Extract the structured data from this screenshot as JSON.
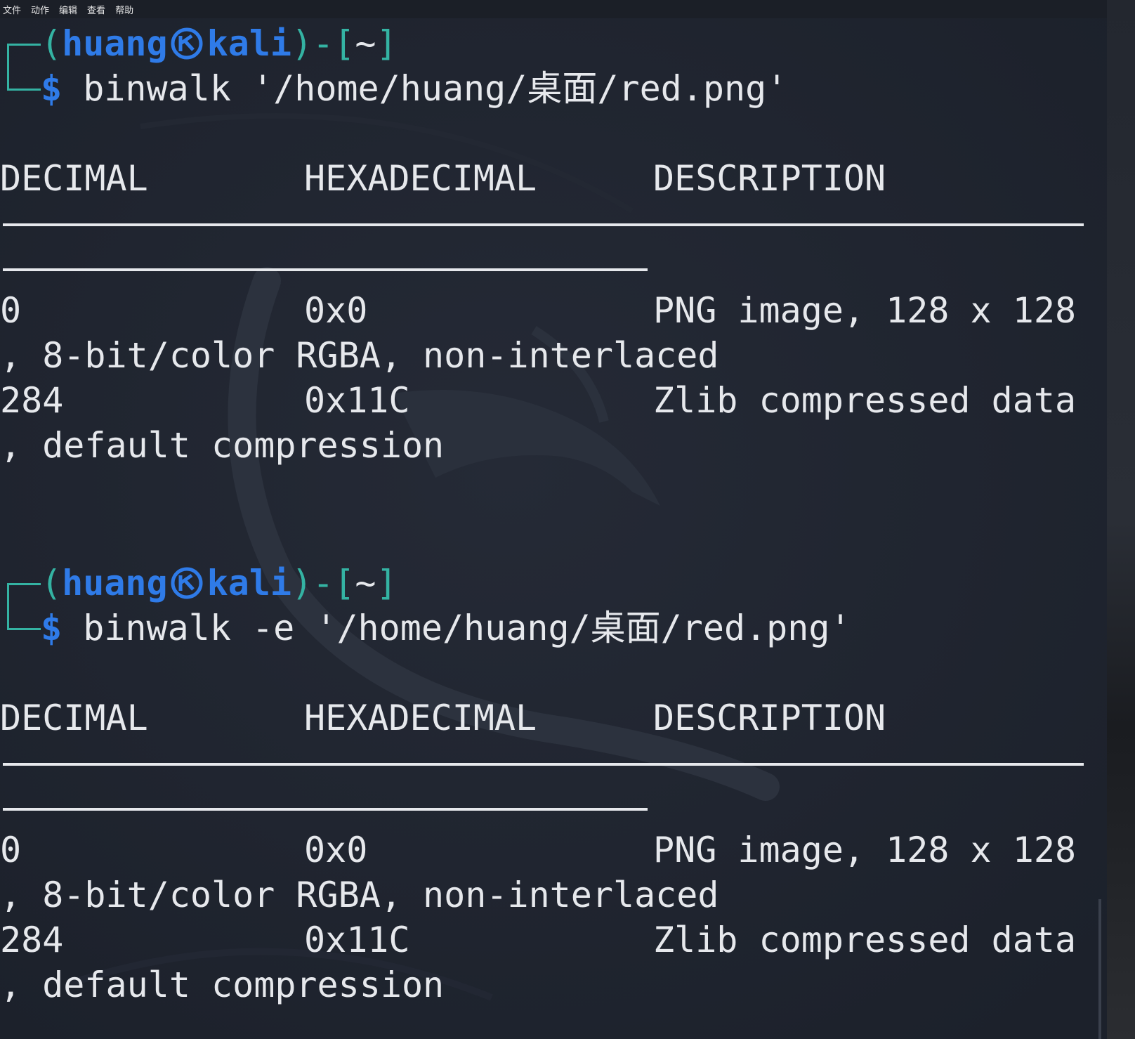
{
  "menu": {
    "items": [
      "文件",
      "动作",
      "编辑",
      "查看",
      "帮助"
    ]
  },
  "blocks": [
    {
      "prompt": {
        "open": "(",
        "user": "huang",
        "host": "kali",
        "close": ")-[",
        "dir": "~",
        "end": "]"
      },
      "dollar": "$",
      "command": " binwalk '/home/huang/桌面/red.png'",
      "headers": [
        "DECIMAL",
        "HEXADECIMAL",
        "DESCRIPTION"
      ],
      "rows": [
        {
          "decimal": "0",
          "hex": "0x0",
          "desc": "PNG image, 128 x 128",
          "cont": ", 8-bit/color RGBA, non-interlaced"
        },
        {
          "decimal": "284",
          "hex": "0x11C",
          "desc": "Zlib compressed data",
          "cont": ", default compression"
        }
      ]
    },
    {
      "prompt": {
        "open": "(",
        "user": "huang",
        "host": "kali",
        "close": ")-[",
        "dir": "~",
        "end": "]"
      },
      "dollar": "$",
      "command": " binwalk -e '/home/huang/桌面/red.png'",
      "headers": [
        "DECIMAL",
        "HEXADECIMAL",
        "DESCRIPTION"
      ],
      "rows": [
        {
          "decimal": "0",
          "hex": "0x0",
          "desc": "PNG image, 128 x 128",
          "cont": ", 8-bit/color RGBA, non-interlaced"
        },
        {
          "decimal": "284",
          "hex": "0x11C",
          "desc": "Zlib compressed data",
          "cont": ", default compression"
        }
      ]
    }
  ],
  "colors": {
    "background": "#1f2430",
    "prompt_bracket": "#34b3a3",
    "prompt_user": "#2f7be8",
    "text": "#e6e8ec"
  },
  "icons": {
    "prompt_separator": "kali-skull-icon"
  }
}
